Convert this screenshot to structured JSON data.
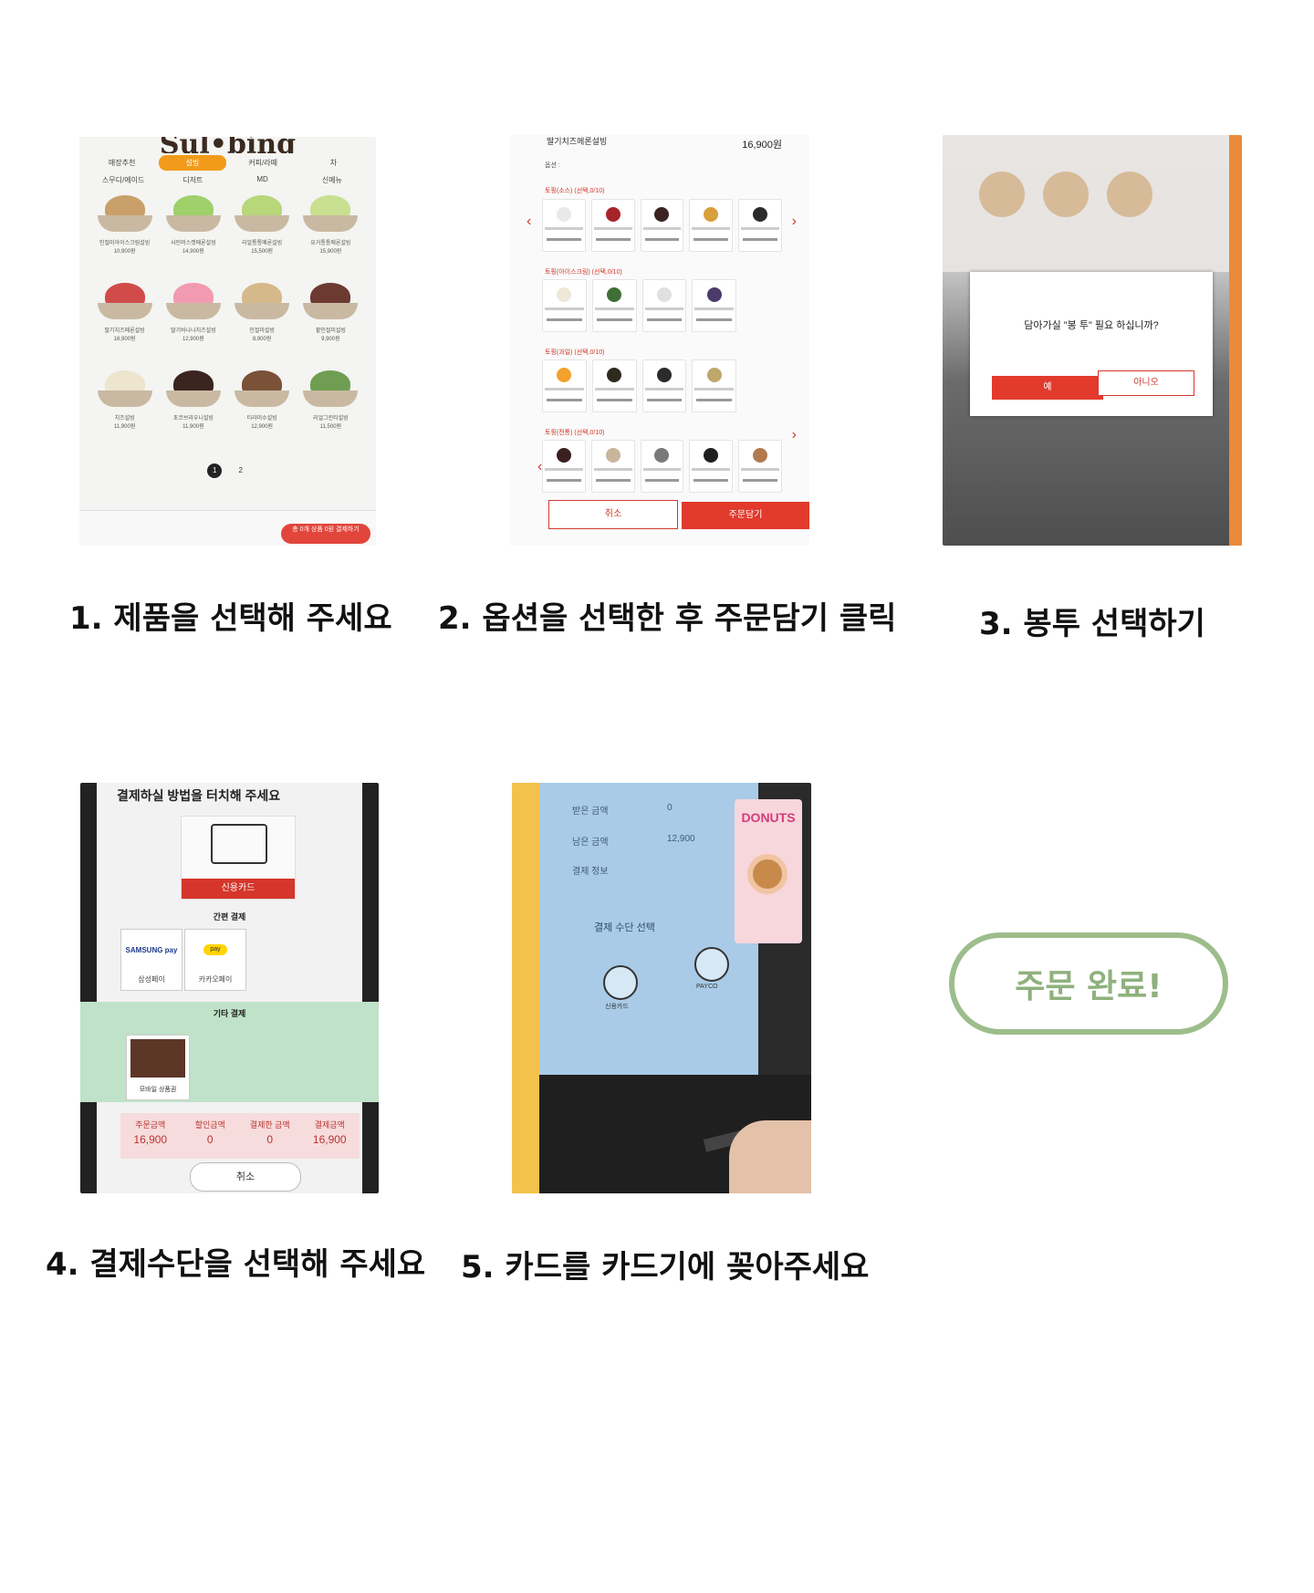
{
  "steps": [
    {
      "caption": "1. 제품을 선택해 주세요"
    },
    {
      "caption": "2. 옵션을 선택한 후 주문담기 클릭"
    },
    {
      "caption": "3. 봉투 선택하기"
    },
    {
      "caption": "4. 결제수단을 선택해 주세요"
    },
    {
      "caption": "5. 카드를 카드기에 꽂아주세요"
    }
  ],
  "done_button": {
    "label": "주문 완료!"
  },
  "photo1": {
    "brand": "Sul•bing",
    "tabs": [
      "매장추천",
      "설빙",
      "커피/라떼",
      "차"
    ],
    "active_tab": 1,
    "subtabs": [
      "스무디/에이드",
      "디저트",
      "MD",
      "신메뉴"
    ],
    "items": [
      {
        "name": "인절미아이스크림설빙",
        "price": "10,900원",
        "color": "#c9a06a"
      },
      {
        "name": "샤인머스캣메론설빙",
        "price": "14,900원",
        "color": "#9fd06a"
      },
      {
        "name": "리얼통통메론설빙",
        "price": "15,500원",
        "color": "#b8d67a"
      },
      {
        "name": "요거통통메론설빙",
        "price": "15,900원",
        "color": "#c8e08f"
      },
      {
        "name": "딸기치즈메론설빙",
        "price": "16,900원",
        "color": "#d14b4b"
      },
      {
        "name": "딸기바나나치즈설빙",
        "price": "12,900원",
        "color": "#f29ab0"
      },
      {
        "name": "인절미설빙",
        "price": "8,900원",
        "color": "#d6b98a"
      },
      {
        "name": "팥인절미설빙",
        "price": "9,900원",
        "color": "#6d3a32"
      },
      {
        "name": "치즈설빙",
        "price": "11,900원",
        "color": "#eee5cf"
      },
      {
        "name": "초코브라우니설빙",
        "price": "11,900원",
        "color": "#3b2520"
      },
      {
        "name": "티라미수설빙",
        "price": "12,900원",
        "color": "#7a5238"
      },
      {
        "name": "리얼그린티설빙",
        "price": "11,500원",
        "color": "#6f9e52"
      }
    ],
    "pages": [
      "1",
      "2"
    ],
    "pay_button": "총 0개 상품 0원 결제하기"
  },
  "photo2": {
    "title": "딸기치즈메론설빙",
    "price": "16,900원",
    "option_label": "옵션 :",
    "sections": [
      {
        "label": "토핑(소스) (선택,0/10)"
      },
      {
        "label": "토핑(아이스크림) (선택,0/10)"
      },
      {
        "label": "토핑(과일) (선택,0/10)"
      },
      {
        "label": "토핑(전통) (선택,0/10)"
      }
    ],
    "cancel": "취소",
    "order": "주문담기"
  },
  "photo3": {
    "question": "담아가실 \"봉 투\" 필요 하십니까?",
    "yes": "예",
    "no": "아니오"
  },
  "photo4": {
    "header": "결제하실 방법을 터치해 주세요",
    "card_label": "신용카드",
    "simple_title": "간편 결제",
    "samsung_logo": "SAMSUNG pay",
    "samsung_label": "삼성페이",
    "kakao_logo": "pay",
    "kakao_label": "카카오페이",
    "other_title": "기타 결제",
    "gift_label": "모바일 상품권",
    "summary": [
      {
        "label": "주문금액",
        "value": "16,900"
      },
      {
        "label": "할인금액",
        "value": "0"
      },
      {
        "label": "결제한 금액",
        "value": "0"
      },
      {
        "label": "결제금액",
        "value": "16,900"
      }
    ],
    "cancel": "취소"
  },
  "photo5": {
    "rows": [
      {
        "label": "받은 금액",
        "value": "0"
      },
      {
        "label": "남은 금액",
        "value": "12,900"
      },
      {
        "label": "결제 정보",
        "value": ""
      }
    ],
    "select_title": "결제 수단 선택",
    "option1": "신용카드",
    "option2": "PAYCO",
    "ad_title": "DONUTS"
  }
}
